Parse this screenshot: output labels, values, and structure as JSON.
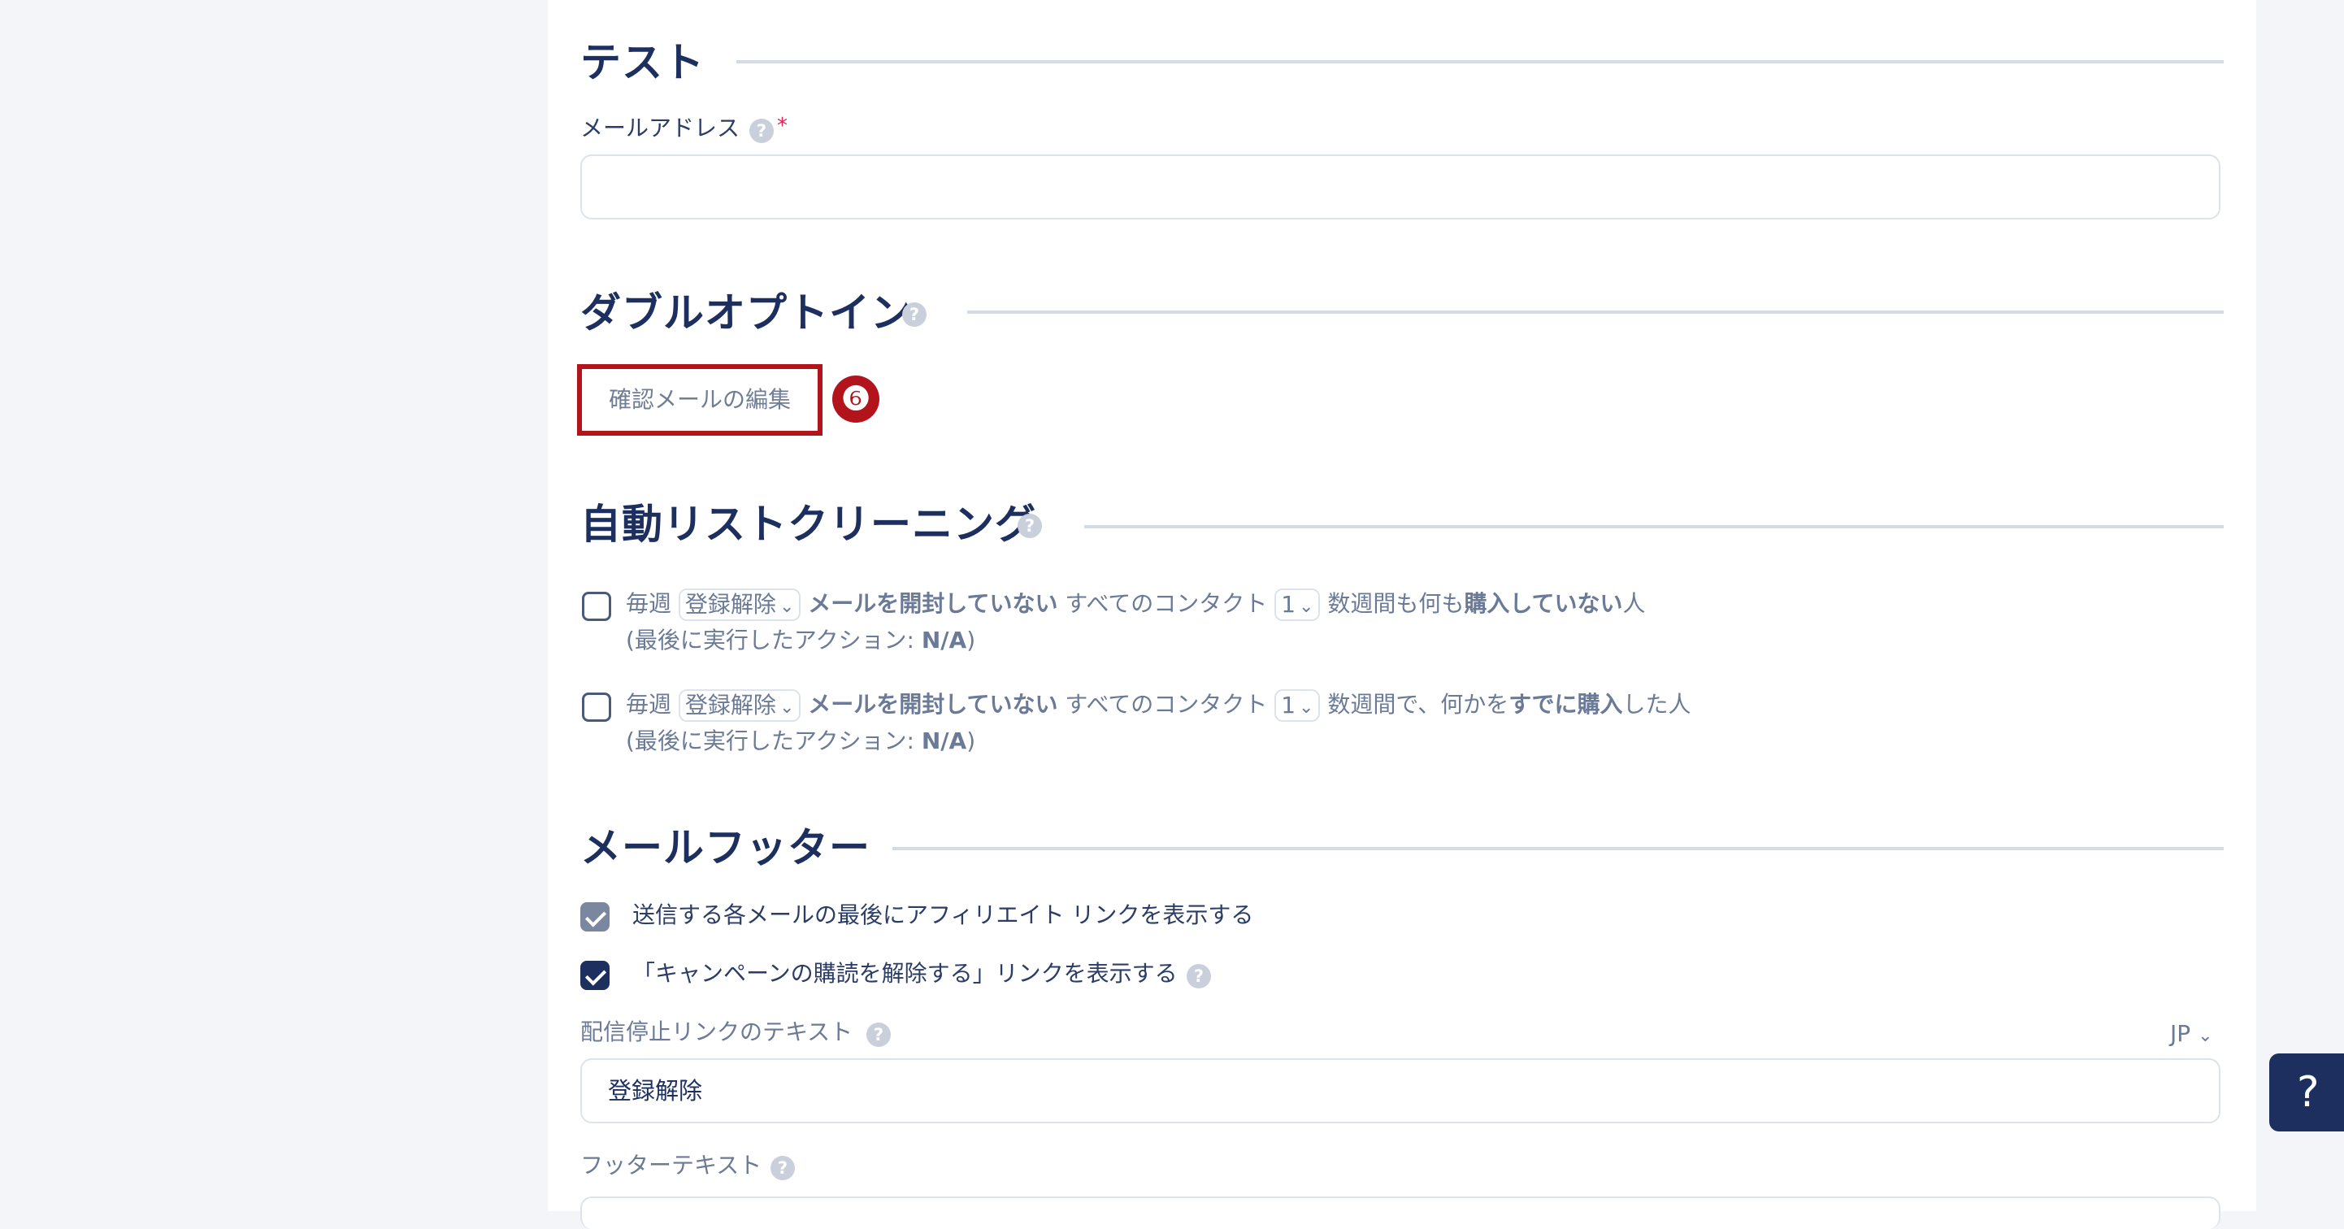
{
  "sections": {
    "test": {
      "title": "テスト",
      "email_label": "メールアドレス",
      "required_mark": "*",
      "email_value": ""
    },
    "double_optin": {
      "title": "ダブルオプトイン",
      "edit_button": "確認メールの編集",
      "callout_number": "❻"
    },
    "auto_clean": {
      "title": "自動リストクリーニング",
      "rules": [
        {
          "checked": false,
          "prefix": "毎週",
          "action": "登録解除",
          "condition_bold": "メールを開封していない",
          "middle": "すべてのコンタクト",
          "weeks": "1",
          "tail_a": "数週間も何も",
          "tail_bold": "購入していない",
          "tail_b": "人",
          "last_run_prefix": "(最後に実行したアクション: ",
          "last_run_value": "N/A",
          "last_run_suffix": ")"
        },
        {
          "checked": false,
          "prefix": "毎週",
          "action": "登録解除",
          "condition_bold": "メールを開封していない",
          "middle": "すべてのコンタクト",
          "weeks": "1",
          "tail_a": "数週間で、何かを",
          "tail_bold": "すでに購入",
          "tail_b": "した人",
          "last_run_prefix": "(最後に実行したアクション: ",
          "last_run_value": "N/A",
          "last_run_suffix": ")"
        }
      ]
    },
    "footer": {
      "title": "メールフッター",
      "affiliate_label": "送信する各メールの最後にアフィリエイト リンクを表示する",
      "unsubscribe_label": "「キャンペーンの購読を解除する」リンクを表示する",
      "unsub_text_label": "配信停止リンクのテキスト",
      "language": "JP",
      "unsub_text_value": "登録解除",
      "footer_text_label": "フッターテキスト"
    }
  },
  "help_glyph": "?",
  "help_button": "?",
  "icons": {
    "help": "help-circle-icon",
    "chevron": "chevron-down-icon",
    "check": "checkmark-icon"
  },
  "colors": {
    "primary": "#1c2f5e",
    "accent_red": "#b3141c",
    "muted": "#6b7a96",
    "background": "#f3f5f8"
  }
}
